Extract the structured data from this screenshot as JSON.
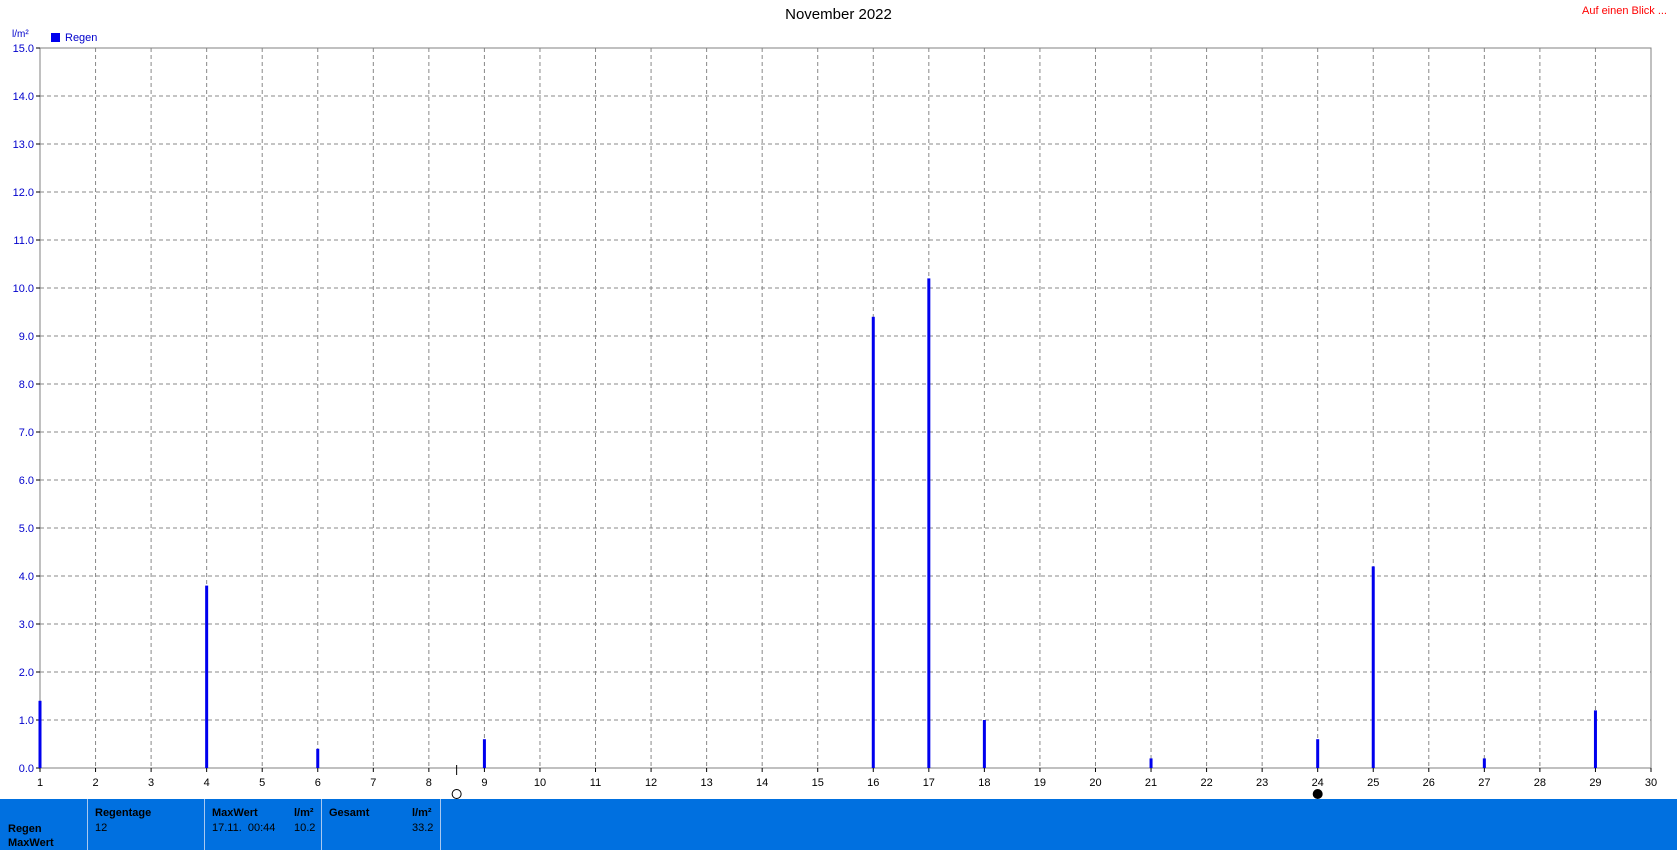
{
  "title": "November 2022",
  "link_label": "Auf einen Blick ...",
  "chart_data": {
    "type": "bar",
    "title": "November 2022",
    "ylabel": "l/m²",
    "ylim": [
      0,
      15
    ],
    "xlim": [
      1,
      30
    ],
    "y_ticks": [
      "0.0",
      "1.0",
      "2.0",
      "3.0",
      "4.0",
      "5.0",
      "6.0",
      "7.0",
      "8.0",
      "9.0",
      "10.0",
      "11.0",
      "12.0",
      "13.0",
      "14.0",
      "15.0"
    ],
    "x_ticks": [
      "1",
      "2",
      "3",
      "4",
      "5",
      "6",
      "7",
      "8",
      "9",
      "10",
      "11",
      "12",
      "13",
      "14",
      "15",
      "16",
      "17",
      "18",
      "19",
      "20",
      "21",
      "22",
      "23",
      "24",
      "25",
      "26",
      "27",
      "28",
      "29",
      "30"
    ],
    "grid": true,
    "legend_position": "top-left",
    "series": [
      {
        "name": "Regen",
        "color": "#0000ee",
        "points": [
          {
            "x": 1,
            "y": 1.4
          },
          {
            "x": 4,
            "y": 3.8
          },
          {
            "x": 6,
            "y": 0.4
          },
          {
            "x": 9,
            "y": 0.6
          },
          {
            "x": 16,
            "y": 9.4
          },
          {
            "x": 17,
            "y": 10.2
          },
          {
            "x": 18,
            "y": 1.0
          },
          {
            "x": 21,
            "y": 0.2
          },
          {
            "x": 24,
            "y": 0.6
          },
          {
            "x": 25,
            "y": 4.2
          },
          {
            "x": 27,
            "y": 0.2
          },
          {
            "x": 29,
            "y": 1.2
          }
        ]
      }
    ],
    "moon_markers": [
      {
        "x": 8.5,
        "phase": "full-moon"
      },
      {
        "x": 24,
        "phase": "new-moon"
      }
    ]
  },
  "stats": {
    "row_label_1": "Regen",
    "row_label_2": "MaxWert",
    "regentage_head": "Regentage",
    "regentage_value": "12",
    "maxwert_head": "MaxWert",
    "maxwert_unit": "l/m²",
    "maxwert_time": "17.11.  00:44",
    "maxwert_value": "10.2",
    "gesamt_head": "Gesamt",
    "gesamt_unit": "l/m²",
    "gesamt_value": "33.2"
  }
}
